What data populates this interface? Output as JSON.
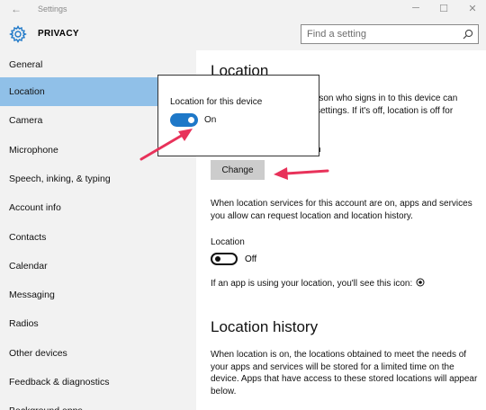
{
  "window": {
    "title": "Settings",
    "back_glyph": "←",
    "minimize_glyph": "─",
    "maximize_glyph": "☐",
    "close_glyph": "✕"
  },
  "header": {
    "icon": "gear-icon",
    "title": "PRIVACY"
  },
  "search": {
    "placeholder": "Find a setting",
    "icon": "search-icon"
  },
  "sidebar": {
    "active_color": "#90c0e8",
    "items": [
      {
        "label": "General"
      },
      {
        "label": "Location",
        "active": true
      },
      {
        "label": "Camera"
      },
      {
        "label": "Microphone"
      },
      {
        "label": "Speech, inking, & typing"
      },
      {
        "label": "Account info"
      },
      {
        "label": "Contacts"
      },
      {
        "label": "Calendar"
      },
      {
        "label": "Messaging"
      },
      {
        "label": "Radios"
      },
      {
        "label": "Other devices"
      },
      {
        "label": "Feedback & diagnostics"
      },
      {
        "label": "Background apps"
      }
    ]
  },
  "main": {
    "heading": "Location",
    "intro_visible_1": "rson who signs in to this device can",
    "intro_visible_2": "settings. If it's off, location is off for",
    "intro_visible_3": "n",
    "change_button": "Change",
    "account_text": "When location services for this account are on, apps and services you allow can request location and location history.",
    "location_label": "Location",
    "location_toggle_state": "Off",
    "icon_note": "If an app is using your location, you'll see this icon:",
    "history_heading": "Location history",
    "history_text": "When location is on, the locations obtained to meet the needs of your apps and services will be stored for a limited time on the device. Apps that have access to these stored locations will appear below."
  },
  "popup": {
    "label": "Location for this device",
    "toggle_state": "On",
    "accent": "#1e78c8"
  },
  "annotations": {
    "arrow_color": "#e8325a"
  }
}
